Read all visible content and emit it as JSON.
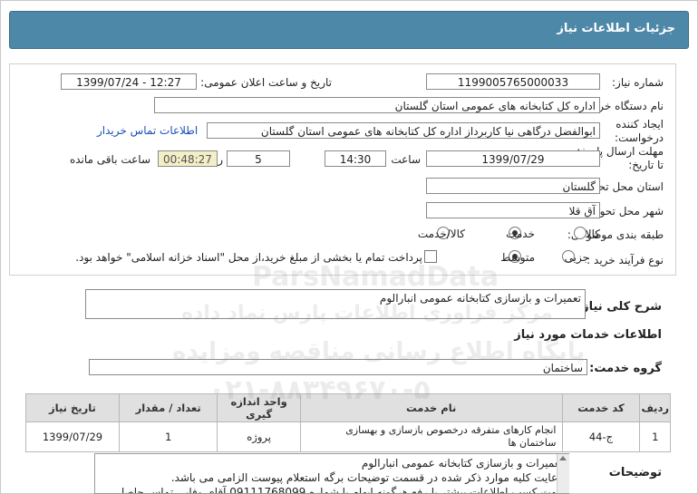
{
  "header": {
    "title": "جزئیات اطلاعات نیاز"
  },
  "form": {
    "need_number_label": "شماره نیاز:",
    "need_number": "1199005765000033",
    "announce_label": "تاریخ و ساعت اعلان عمومی:",
    "announce_value": "1399/07/24 - 12:27",
    "buyer_label": "نام دستگاه خریدار:",
    "buyer_value": "اداره کل کتابخانه های عمومی استان گلستان",
    "creator_label_1": "ایجاد کننده",
    "creator_label_2": "درخواست:",
    "creator_value": "ابوالفضل  درگاهی نیا کاربرداز اداره کل کتابخانه های عمومی استان گلستان",
    "contact_link": "اطلاعات تماس خریدار",
    "deadline_label_1": "مهلت ارسال پاسخ:",
    "deadline_label_2": "تا تاریخ:",
    "deadline_date": "1399/07/29",
    "time_label": "ساعت",
    "deadline_time": "14:30",
    "days_value": "5",
    "days_label": "روز و",
    "remaining_time": "00:48:27",
    "remaining_label": "ساعت باقی مانده",
    "province_label": "استان محل تحویل:",
    "province_value": "گلستان",
    "city_label": "شهر محل تحویل:",
    "city_value": "آق قلا",
    "category_label": "طبقه بندی موضوعی:",
    "category_options": [
      "کالا",
      "خدمت",
      "کالا/خدمت"
    ],
    "process_label": "نوع فرآیند خرید :",
    "process_options": [
      "جزیی",
      "متوسط"
    ],
    "treasury_text": "پرداخت تمام یا بخشی از مبلغ خرید،از محل \"اسناد خزانه اسلامی\" خواهد بود."
  },
  "summary": {
    "label": "شرح کلی نیاز:",
    "value": "تعمیرات و بازسازی کتابخانه عمومی انبارالوم"
  },
  "services_title": "اطلاعات خدمات مورد نیاز",
  "service_group": {
    "label": "گروه خدمت:",
    "value": "ساختمان"
  },
  "table": {
    "headers": [
      "ردیف",
      "کد خدمت",
      "نام خدمت",
      "واحد اندازه گیری",
      "تعداد / مقدار",
      "تاریخ نیاز"
    ],
    "rows": [
      [
        "1",
        "ج-44",
        "انجام کارهای متفرقه درخصوص بازسازی و بهسازی ساختمان ها",
        "پروژه",
        "1",
        "1399/07/29"
      ]
    ]
  },
  "description": {
    "label": "توضیحات",
    "lines": [
      "تعمیرات و بازسازی کتابخانه عمومی انبارالوم",
      "رعایت کلیه موارد ذکر شده در قسمت توضیحات برگه استعلام پیوست الزامی می باشد.",
      "جهت کسب اطلاعات بیشتر یا رفع هرگونه ابهام با شماره 09111768099 آقای وفایی تماس حاصل"
    ]
  },
  "watermark": {
    "brand": "ParsNamadData",
    "line1": "مرکز فراوری اطلاعات پارس نماد داده",
    "line2": "پایگاه اطلاع رسانی مناقصه ومزایده",
    "phone": "۰۲۱-۸۸۳۴۹۶۷۰-۵"
  },
  "colors": {
    "title_bar": "#4e88a8",
    "link": "#1a4fb5",
    "timer_bg": "#f4eec6"
  }
}
